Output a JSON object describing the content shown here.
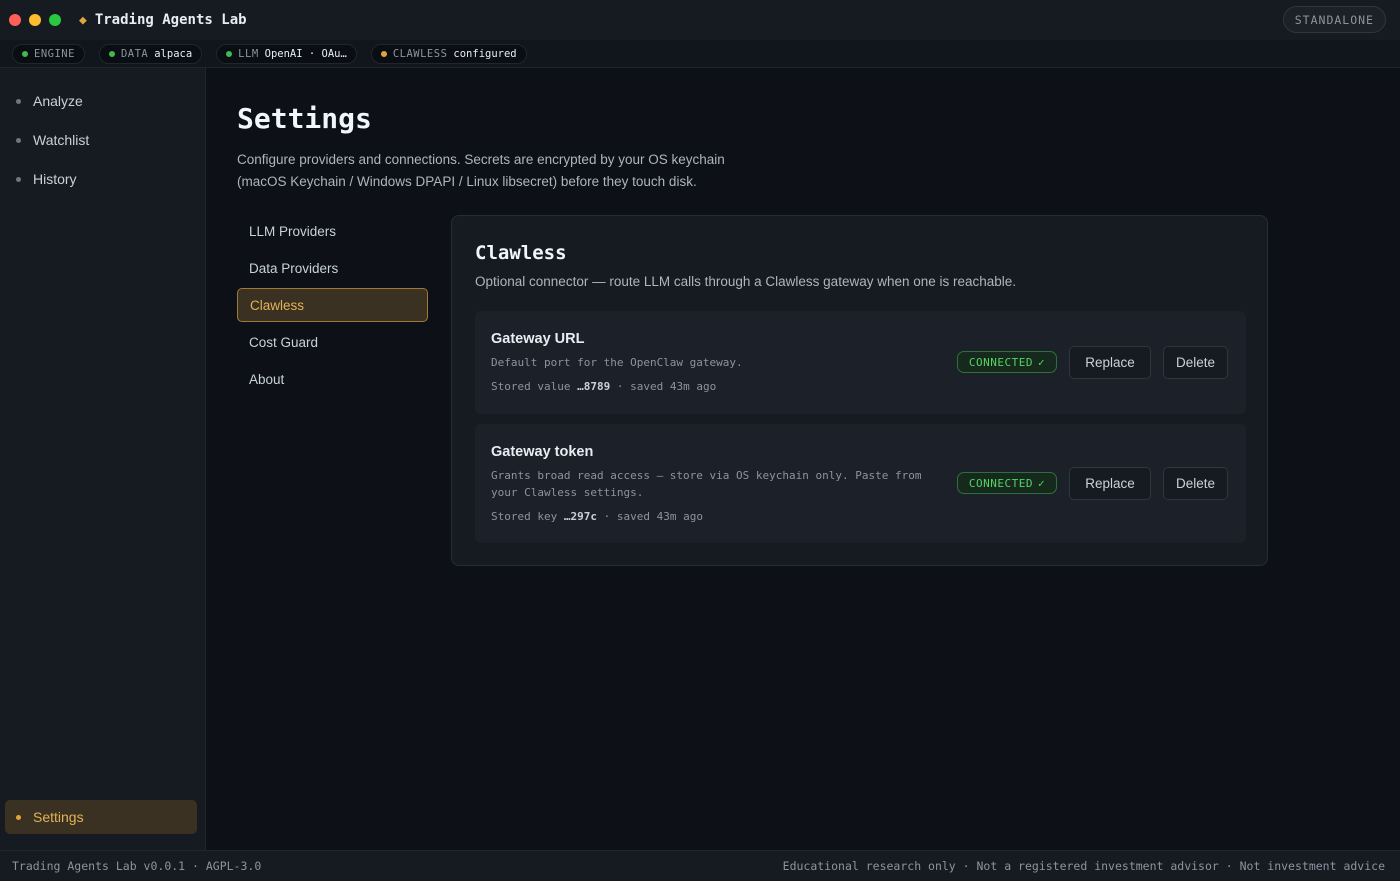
{
  "app": {
    "title": "Trading Agents Lab",
    "mode_badge": "STANDALONE"
  },
  "status_chips": [
    {
      "key": "ENGINE",
      "value": "",
      "status_color": "#3fb950"
    },
    {
      "key": "DATA",
      "value": "alpaca",
      "status_color": "#3fb950"
    },
    {
      "key": "LLM",
      "value": "OpenAI · OAu…",
      "status_color": "#3fb950"
    },
    {
      "key": "CLAWLESS",
      "value": "configured",
      "status_color": "#e3a53b"
    }
  ],
  "sidebar": {
    "items": [
      {
        "label": "Analyze"
      },
      {
        "label": "Watchlist"
      },
      {
        "label": "History"
      }
    ],
    "bottom_item": {
      "label": "Settings",
      "active": true
    }
  },
  "page": {
    "title": "Settings",
    "description": "Configure providers and connections. Secrets are encrypted by your OS keychain (macOS Keychain / Windows DPAPI / Linux libsecret) before they touch disk."
  },
  "settings_nav": {
    "items": [
      {
        "label": "LLM Providers"
      },
      {
        "label": "Data Providers"
      },
      {
        "label": "Clawless",
        "active": true
      },
      {
        "label": "Cost Guard"
      },
      {
        "label": "About"
      }
    ]
  },
  "panel": {
    "title": "Clawless",
    "description": "Optional connector — route LLM calls through a Clawless gateway when one is reachable.",
    "cards": [
      {
        "title": "Gateway URL",
        "description": "Default port for the OpenClaw gateway.",
        "meta_prefix": "Stored value",
        "meta_value": "…8789",
        "meta_suffix": "· saved 43m ago",
        "status": "CONNECTED",
        "status_icon": "✓",
        "replace_label": "Replace",
        "delete_label": "Delete"
      },
      {
        "title": "Gateway token",
        "description": "Grants broad read access — store via OS keychain only. Paste from your Clawless settings.",
        "meta_prefix": "Stored key",
        "meta_value": "…297c",
        "meta_suffix": "· saved 43m ago",
        "status": "CONNECTED",
        "status_icon": "✓",
        "replace_label": "Replace",
        "delete_label": "Delete"
      }
    ]
  },
  "footer": {
    "left": "Trading Agents Lab v0.0.1 · AGPL-3.0",
    "right": "Educational research only · Not a registered investment advisor · Not investment advice"
  },
  "colors": {
    "accent": "#e3a53b",
    "success": "#3fb950",
    "background": "#0d1117"
  }
}
